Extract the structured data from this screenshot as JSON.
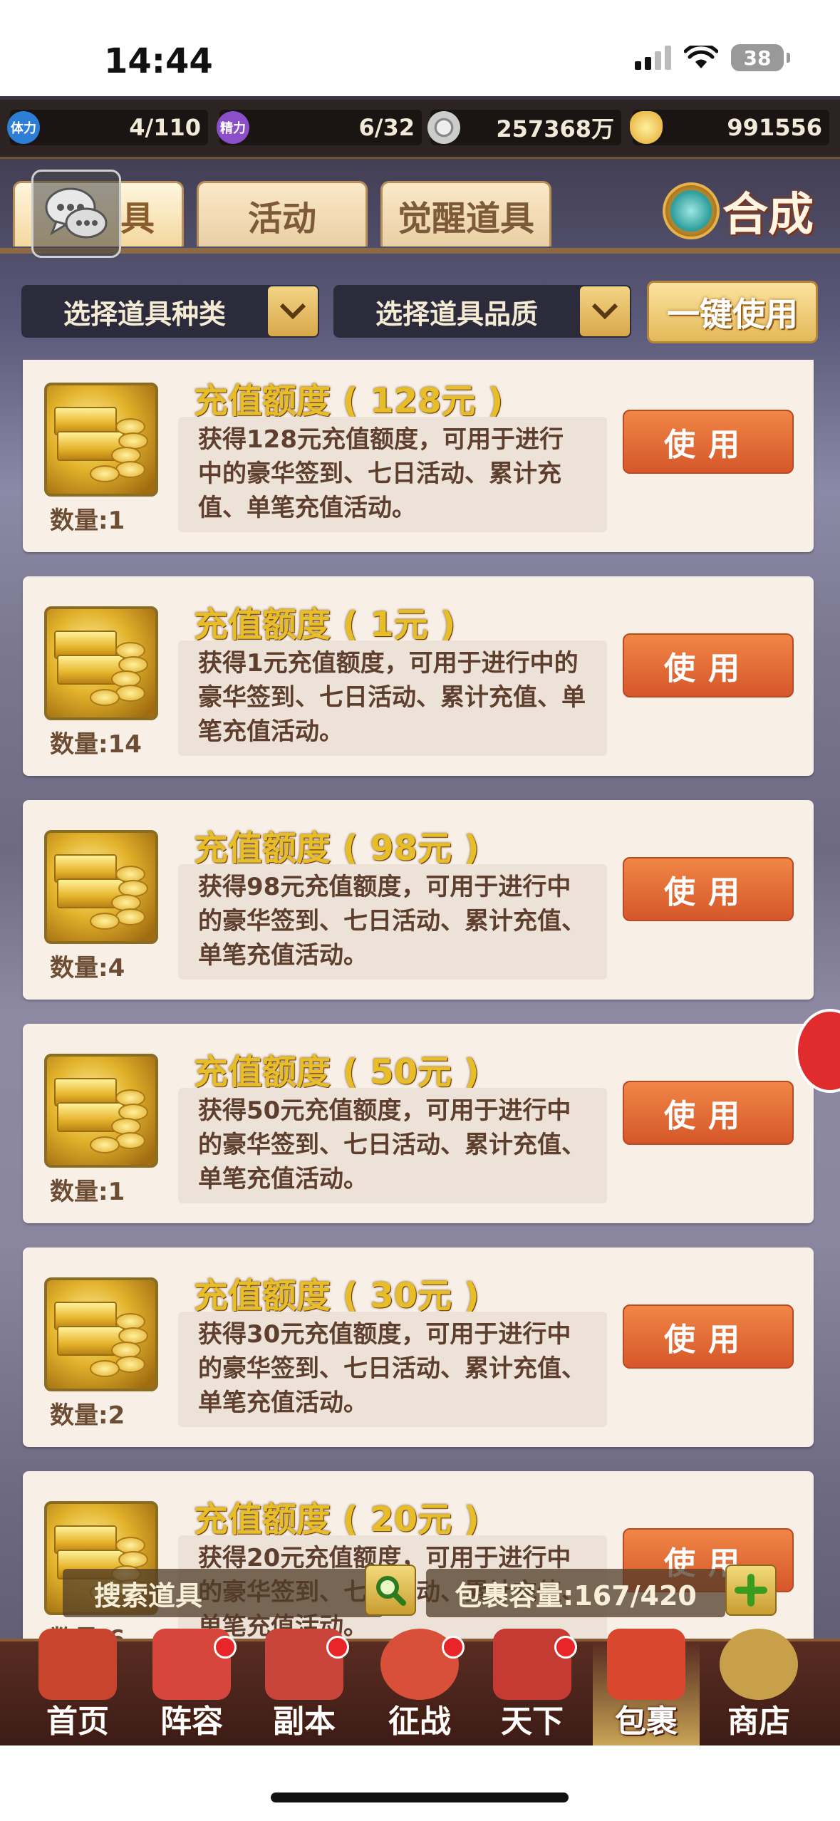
{
  "status_bar": {
    "time": "14:44",
    "battery": "38"
  },
  "resources": [
    {
      "icon": "stamina-icon",
      "icon_text": "体力",
      "value": "4/110",
      "color": "#2d7fd6"
    },
    {
      "icon": "energy-icon",
      "icon_text": "精力",
      "value": "6/32",
      "color": "#8a4fc9"
    },
    {
      "icon": "silver-coin-icon",
      "icon_text": "",
      "value": "257368万",
      "color": "#b8b8b8"
    },
    {
      "icon": "gold-ingot-icon",
      "icon_text": "",
      "value": "991556",
      "color": "#e3a82a"
    }
  ],
  "tabs": [
    {
      "label": "道具",
      "visible_label": "具",
      "active": true
    },
    {
      "label": "活动",
      "active": false
    },
    {
      "label": "觉醒道具",
      "active": false
    }
  ],
  "synth_label": "合成",
  "filters": {
    "type_label": "选择道具种类",
    "quality_label": "选择道具品质",
    "use_all_label": "一键使用"
  },
  "items": [
    {
      "title": "充值额度 ( 128元 )",
      "desc": "获得128元充值额度，可用于进行中的豪华签到、七日活动、累计充值、单笔充值活动。",
      "qty": "数量:1",
      "use_label": "使用"
    },
    {
      "title": "充值额度 ( 1元 )",
      "desc": "获得1元充值额度，可用于进行中的豪华签到、七日活动、累计充值、单笔充值活动。",
      "qty": "数量:14",
      "use_label": "使用"
    },
    {
      "title": "充值额度 ( 98元 )",
      "desc": "获得98元充值额度，可用于进行中的豪华签到、七日活动、累计充值、单笔充值活动。",
      "qty": "数量:4",
      "use_label": "使用"
    },
    {
      "title": "充值额度 ( 50元 )",
      "desc": "获得50元充值额度，可用于进行中的豪华签到、七日活动、累计充值、单笔充值活动。",
      "qty": "数量:1",
      "use_label": "使用"
    },
    {
      "title": "充值额度 ( 30元 )",
      "desc": "获得30元充值额度，可用于进行中的豪华签到、七日活动、累计充值、单笔充值活动。",
      "qty": "数量:2",
      "use_label": "使用"
    },
    {
      "title": "充值额度 ( 20元 )",
      "desc": "获得20元充值额度，可用于进行中的豪华签到、七日活动、累计充值、单笔充值活动。",
      "qty": "数量:6",
      "use_label": "使用"
    }
  ],
  "search": {
    "placeholder": "搜索道具",
    "capacity": "包裹容量:167/420"
  },
  "nav": [
    {
      "label": "首页",
      "icon": "palace-icon",
      "dot": false,
      "active": false,
      "color": "#c8442c"
    },
    {
      "label": "阵容",
      "icon": "banner-icon",
      "dot": true,
      "active": false,
      "color": "#d6463c"
    },
    {
      "label": "副本",
      "icon": "crossed-swords-icon",
      "dot": true,
      "active": false,
      "color": "#c9443a"
    },
    {
      "label": "征战",
      "icon": "target-icon",
      "dot": true,
      "active": false,
      "color": "#d8503a"
    },
    {
      "label": "天下",
      "icon": "scroll-icon",
      "dot": true,
      "active": false,
      "color": "#c63a34"
    },
    {
      "label": "包裹",
      "icon": "bag-icon",
      "dot": false,
      "active": true,
      "color": "#d9472f"
    },
    {
      "label": "商店",
      "icon": "coins-icon",
      "dot": false,
      "active": false,
      "color": "#c9a04a"
    }
  ]
}
